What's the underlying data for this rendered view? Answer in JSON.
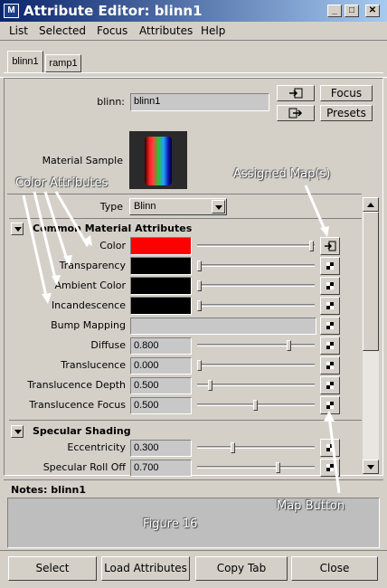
{
  "window": {
    "title": "Attribute Editor: blinn1",
    "app_icon": "maya-icon"
  },
  "menu": [
    "List",
    "Selected",
    "Focus",
    "Attributes",
    "Help"
  ],
  "tabs": [
    "blinn1",
    "ramp1"
  ],
  "header": {
    "node_label": "blinn:",
    "node_value": "blinn1",
    "focus_label": "Focus",
    "presets_label": "Presets",
    "material_sample_label": "Material Sample"
  },
  "type_row": {
    "label": "Type",
    "value": "Blinn"
  },
  "common": {
    "title": "Common Material Attributes",
    "rows": [
      {
        "label": "Color",
        "kind": "color",
        "swatch": "#ff0000",
        "slider": 1.0
      },
      {
        "label": "Transparency",
        "kind": "color",
        "swatch": "#000000",
        "slider": 0.0
      },
      {
        "label": "Ambient Color",
        "kind": "color",
        "swatch": "#000000",
        "slider": 0.0
      },
      {
        "label": "Incandescence",
        "kind": "color",
        "swatch": "#000000",
        "slider": 0.0
      },
      {
        "label": "Bump Mapping",
        "kind": "bump",
        "value": ""
      },
      {
        "label": "Diffuse",
        "kind": "num",
        "value": "0.800",
        "slider": 0.8
      },
      {
        "label": "Translucence",
        "kind": "num",
        "value": "0.000",
        "slider": 0.0
      },
      {
        "label": "Translucence Depth",
        "kind": "num",
        "value": "0.500",
        "slider": 0.1
      },
      {
        "label": "Translucence Focus",
        "kind": "num",
        "value": "0.500",
        "slider": 0.5
      }
    ]
  },
  "specular": {
    "title": "Specular Shading",
    "rows": [
      {
        "label": "Eccentricity",
        "kind": "num",
        "value": "0.300",
        "slider": 0.3
      },
      {
        "label": "Specular Roll Off",
        "kind": "num",
        "value": "0.700",
        "slider": 0.7
      }
    ]
  },
  "notes": {
    "label": "Notes: blinn1",
    "text": ""
  },
  "annotations": {
    "color_attributes": "Color Attributes",
    "assigned_maps": "Assigned Map(s)",
    "map_button": "Map Button",
    "figure": "Figure 16"
  },
  "bottom_buttons": [
    "Select",
    "Load Attributes",
    "Copy Tab",
    "Close"
  ]
}
